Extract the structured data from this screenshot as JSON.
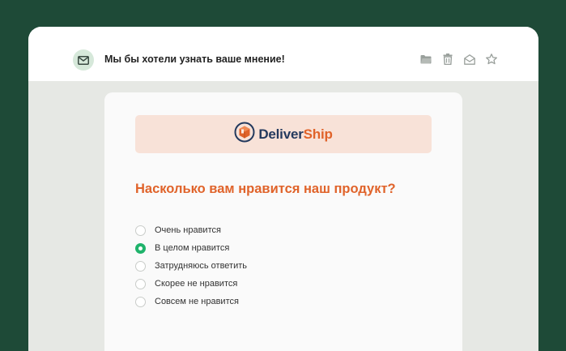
{
  "mail": {
    "subject": "Мы бы хотели узнать ваше мнение!",
    "icons": [
      "mail-icon",
      "folder-icon",
      "trash-icon",
      "open-envelope-icon",
      "star-icon"
    ]
  },
  "brand": {
    "name_part_a": "Deliver",
    "name_part_b": "Ship",
    "colors": {
      "primary": "#243a5e",
      "accent": "#e0632a"
    }
  },
  "survey": {
    "question": "Насколько вам нравится наш продукт?",
    "selected_index": 1,
    "options": [
      {
        "label": "Очень нравится"
      },
      {
        "label": "В целом нравится"
      },
      {
        "label": "Затрудняюсь ответить"
      },
      {
        "label": "Скорее не нравится"
      },
      {
        "label": "Совсем не нравится"
      }
    ]
  },
  "colors": {
    "background": "#1e4a37",
    "selected_radio": "#1fb36b"
  }
}
